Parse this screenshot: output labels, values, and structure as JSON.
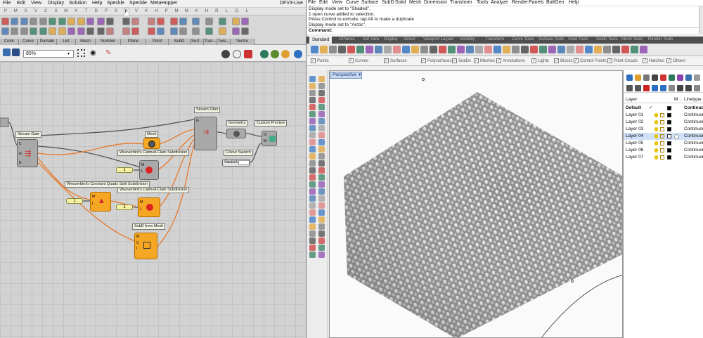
{
  "gh": {
    "menu": [
      "File",
      "Edit",
      "View",
      "Display",
      "Solution",
      "Help",
      "Speckle",
      "Speckle",
      "MetaHopper"
    ],
    "doc_title": "DFV3-Live",
    "tabs": [
      "P",
      "M",
      "S",
      "V",
      "C",
      "S",
      "M",
      "X",
      "T",
      "D",
      "P",
      "S",
      "P",
      "V",
      "K",
      "H",
      "P",
      "M",
      "M",
      "K",
      "H",
      "R",
      "L",
      "D",
      "L"
    ],
    "active_tab_index": 12,
    "ribbon_groups": [
      "Color",
      "Curve",
      "Domain",
      "List",
      "Mesh",
      "Number",
      "Plane",
      "Point",
      "SubD",
      "Surf...",
      "Tran...",
      "Twis...",
      "Vector"
    ],
    "zoom": "85%",
    "nodes": {
      "stream_gate": "Stream Gate",
      "stream_filter": "Stream Filter",
      "geometry": "Geometry",
      "custom_preview": "Custom Preview",
      "mesh": "Mesh",
      "colour_swatch": "Colour Swatch",
      "swatch": "Swatch",
      "wb_cc_1": "Weaverbird's Catmull-Clark Subdivision",
      "wb_cq": "Weaverbird's Constant Quads Split Subdivision",
      "wb_cc_2": "Weaverbird's Catmull-Clark Subdivision",
      "subd_from_mesh": "SubD from Mesh",
      "slider1": "1",
      "slider2": "1",
      "slider3": "1"
    }
  },
  "rhino": {
    "menu": [
      "File",
      "Edit",
      "View",
      "Curve",
      "Surface",
      "SubD",
      "Solid",
      "Mesh",
      "Dimension",
      "Transform",
      "Tools",
      "Analyze",
      "Render",
      "Panels",
      "BoltGen",
      "Help"
    ],
    "history": [
      "Display mode set to \"Shaded\".",
      "1 open curve added to selection.",
      "Press Control to extrude, tap Alt to make a duplicate",
      "Display mode set to \"Arctic\"."
    ],
    "command_label": "Command:",
    "tabs": [
      "Standard",
      "CPlanes",
      "Set View",
      "Display",
      "Select",
      "Viewport Layout",
      "Visibility",
      "Transform",
      "Curve Tools",
      "Surface Tools",
      "Solid Tools",
      "SubD Tools",
      "Mesh Tools",
      "Render Tools"
    ],
    "osnaps": [
      {
        "label": "Points",
        "checked": true
      },
      {
        "label": "Curves",
        "checked": true
      },
      {
        "label": "Surfaces",
        "checked": true
      },
      {
        "label": "Polysurfaces",
        "checked": true
      },
      {
        "label": "SubDs",
        "checked": true
      },
      {
        "label": "Meshes",
        "checked": true
      },
      {
        "label": "Annotations",
        "checked": true
      },
      {
        "label": "Lights",
        "checked": true
      },
      {
        "label": "Blocks",
        "checked": true
      },
      {
        "label": "Control Points",
        "checked": true
      },
      {
        "label": "Point Clouds",
        "checked": true
      },
      {
        "label": "Hatches",
        "checked": true
      },
      {
        "label": "Others",
        "checked": true
      }
    ],
    "viewport_label": "Perspective",
    "layers_panel": {
      "headers": {
        "layer": "Layer",
        "material": "M...",
        "linetype": "Linetype"
      },
      "rows": [
        {
          "name": "Default",
          "linetype": "Continuous",
          "current": true,
          "color": "#000000"
        },
        {
          "name": "Layer 01",
          "linetype": "Continuous",
          "color": "#000000"
        },
        {
          "name": "Layer 02",
          "linetype": "Continuous",
          "color": "#000000"
        },
        {
          "name": "Layer 03",
          "linetype": "Continuous",
          "color": "#000000"
        },
        {
          "name": "Layer 04",
          "linetype": "Continuous",
          "selected": true,
          "color": "#ffffff"
        },
        {
          "name": "Layer 05",
          "linetype": "Continuous",
          "color": "#000000"
        },
        {
          "name": "Layer 06",
          "linetype": "Continuous",
          "color": "#000000"
        },
        {
          "name": "Layer 07",
          "linetype": "Continuous",
          "color": "#000000"
        }
      ]
    }
  },
  "colors": {
    "gh_orange": "#f5a623",
    "gh_wire_orange": "#e8782a",
    "gh_wire_dark": "#555555",
    "rhino_selected": "#cfe0f7"
  }
}
